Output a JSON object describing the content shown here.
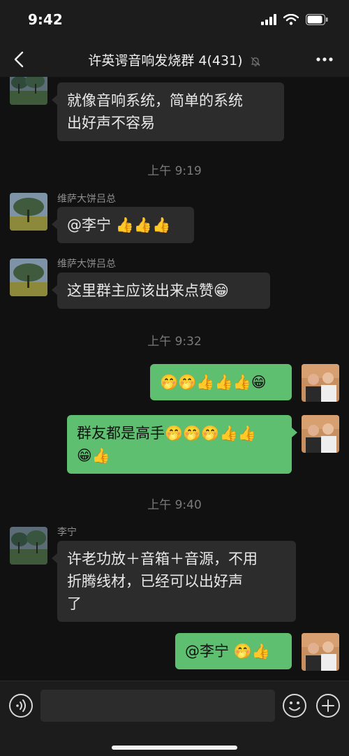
{
  "status_bar": {
    "time": "9:42"
  },
  "header": {
    "title": "许英谔音响发烧群 4(431)"
  },
  "messages": [
    {
      "text_line1": "就像音响系统，简单的系统",
      "text_line2": "出好声不容易"
    },
    {
      "timestamp": "上午 9:19"
    },
    {
      "sender": "维萨大饼吕总",
      "text": "@李宁 👍👍👍"
    },
    {
      "sender": "维萨大饼吕总",
      "text": "这里群主应该出来点赞😁"
    },
    {
      "timestamp": "上午 9:32"
    },
    {
      "text": "🤭🤭👍👍👍😁"
    },
    {
      "text_line1": "群友都是高手🤭🤭🤭👍👍",
      "text_line2": "😁👍"
    },
    {
      "timestamp": "上午 9:40"
    },
    {
      "sender": "李宁",
      "text_line1": "许老功放＋音箱＋音源，不用",
      "text_line2": "折腾线材，已经可以出好声",
      "text_line3": "了"
    },
    {
      "text": "@李宁 🤭👍"
    }
  ],
  "input": {
    "placeholder": ""
  },
  "icons": {
    "back": "chevron-left-icon",
    "mute": "bell-slash-icon",
    "more": "ellipsis-icon",
    "voice": "voice-icon",
    "emoji": "emoji-icon",
    "plus": "plus-icon"
  },
  "colors": {
    "background": "#111111",
    "bar": "#1c1c1c",
    "incoming_bubble": "#2c2c2c",
    "outgoing_bubble": "#5fbf70"
  }
}
